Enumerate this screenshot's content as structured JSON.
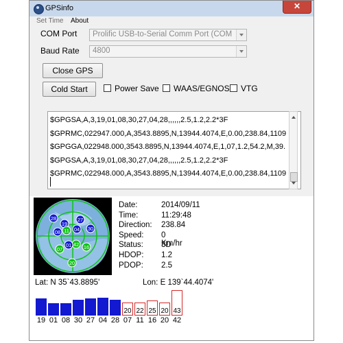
{
  "window": {
    "title": "GPSinfo"
  },
  "menu": {
    "items": [
      "Set Time",
      "About"
    ]
  },
  "controls": {
    "com_port_label": "COM Port",
    "com_port_value": "Prolific USB-to-Serial Comm Port (COM",
    "baud_rate_label": "Baud Rate",
    "baud_rate_value": "4800",
    "close_gps": "Close GPS",
    "cold_start": "Cold Start",
    "power_save": "Power Save",
    "waas": "WAAS/EGNOS",
    "vtg": "VTG"
  },
  "nmea": {
    "lines": [
      "$GPGSA,A,3,19,01,08,30,27,04,28,,,,,,2.5,1.2,2.2*3F",
      "$GPRMC,022947.000,A,3543.8895,N,13944.4074,E,0.00,238.84,1109",
      "$GPGGA,022948.000,3543.8895,N,13944.4074,E,1,07,1.2,54.2,M,39.",
      "$GPGSA,A,3,19,01,08,30,27,04,28,,,,,,2.5,1.2,2.2*3F",
      "$GPRMC,022948.000,A,3543.8895,N,13944.4074,E,0.00,238.84,1109"
    ]
  },
  "status": {
    "date_label": "Date:",
    "date": "2014/09/11",
    "time_label": "Time:",
    "time": "11:29:48",
    "direction_label": "Direction:",
    "direction": "238.84",
    "speed_label": "Speed:",
    "speed": "0 Km/hr",
    "status_label": "Status:",
    "status": "3D",
    "hdop_label": "HDOP:",
    "hdop": "1.2",
    "pdop_label": "PDOP:",
    "pdop": "2.5",
    "lat": "Lat:  N  35`43.8895'",
    "lon": "Lon: E  139`44.4074'"
  },
  "skyplot": {
    "satellites": [
      {
        "id": "28",
        "used": true
      },
      {
        "id": "19",
        "used": true
      },
      {
        "id": "27",
        "used": true
      },
      {
        "id": "30",
        "used": true
      },
      {
        "id": "08",
        "used": true
      },
      {
        "id": "11",
        "used": false
      },
      {
        "id": "04",
        "used": true
      },
      {
        "id": "42",
        "used": false
      },
      {
        "id": "01",
        "used": true
      },
      {
        "id": "16",
        "used": false
      },
      {
        "id": "07",
        "used": false
      },
      {
        "id": "20",
        "used": false
      }
    ]
  },
  "snr_bars": [
    {
      "id": "19",
      "level": 0.62,
      "used": true
    },
    {
      "id": "01",
      "level": 0.46,
      "used": true
    },
    {
      "id": "08",
      "level": 0.46,
      "used": true
    },
    {
      "id": "30",
      "level": 0.58,
      "used": true
    },
    {
      "id": "27",
      "level": 0.62,
      "used": true
    },
    {
      "id": "04",
      "level": 0.66,
      "used": true
    },
    {
      "id": "28",
      "level": 0.58,
      "used": true
    },
    {
      "id": "07",
      "level": 0.48,
      "used": false,
      "value": "20"
    },
    {
      "id": "11",
      "level": 0.48,
      "used": false,
      "value": "22"
    },
    {
      "id": "16",
      "level": 0.54,
      "used": false,
      "value": "25"
    },
    {
      "id": "20",
      "level": 0.48,
      "used": false,
      "value": "20"
    },
    {
      "id": "42",
      "level": 0.92,
      "used": false,
      "value": "43"
    }
  ],
  "colors": {
    "used_bar": "#1219d0",
    "visible_bar_border": "#d42828",
    "sky_blue": "#7db0dd",
    "sky_green": "#10c218"
  }
}
